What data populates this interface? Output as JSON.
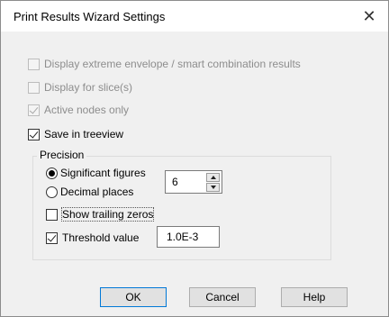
{
  "window": {
    "title": "Print Results Wizard Settings"
  },
  "options": {
    "display_extreme": {
      "label": "Display extreme envelope / smart combination results",
      "checked": false,
      "disabled": true
    },
    "display_slices": {
      "label": "Display for slice(s)",
      "checked": false,
      "disabled": true
    },
    "active_nodes": {
      "label": "Active nodes only",
      "checked": true,
      "disabled": true
    },
    "save_treeview": {
      "label": "Save in treeview",
      "checked": true,
      "disabled": false
    }
  },
  "precision": {
    "title": "Precision",
    "significant_figures": {
      "label": "Significant figures",
      "selected": true
    },
    "decimal_places": {
      "label": "Decimal places",
      "selected": false
    },
    "value": "6",
    "show_trailing_zeros": {
      "label": "Show trailing zeros",
      "checked": false
    },
    "threshold": {
      "label": "Threshold value",
      "checked": true,
      "value": "1.0E-3"
    }
  },
  "buttons": {
    "ok": "OK",
    "cancel": "Cancel",
    "help": "Help"
  },
  "colors": {
    "default_button_border": "#0078d7",
    "dialog_bg": "#f0f0f0"
  }
}
